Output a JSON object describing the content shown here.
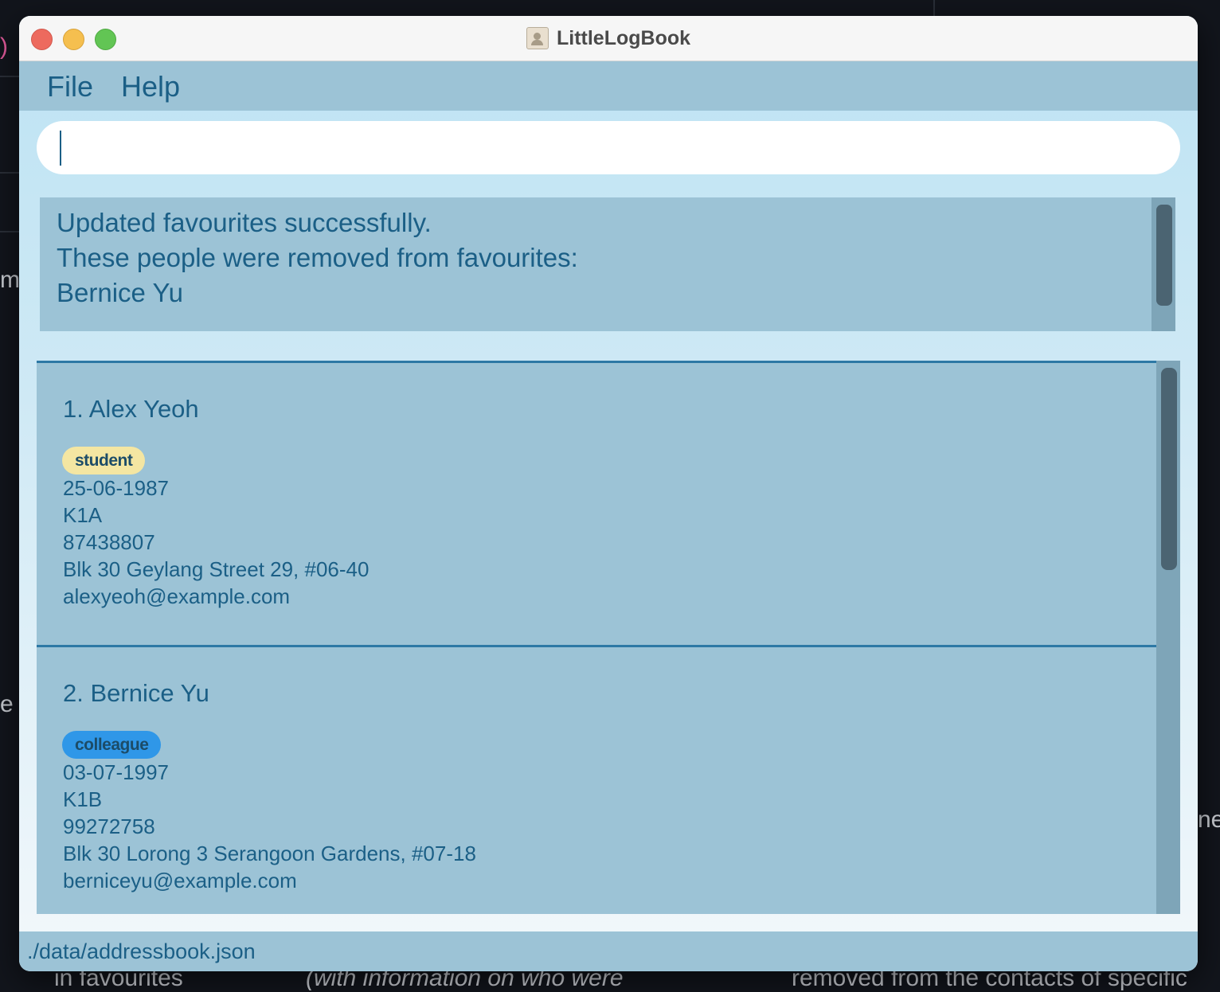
{
  "window": {
    "title": "LittleLogBook"
  },
  "menu": {
    "file": "File",
    "help": "Help"
  },
  "command": {
    "value": "",
    "placeholder": ""
  },
  "result": {
    "lines": [
      "Updated favourites successfully.",
      "These people were removed from favourites:",
      "Bernice Yu"
    ]
  },
  "persons": [
    {
      "name": "1. Alex Yeoh",
      "tag": "student",
      "birthday": "25-06-1987",
      "code": "K1A",
      "phone": "87438807",
      "address": "Blk 30 Geylang Street 29, #06-40",
      "email": "alexyeoh@example.com"
    },
    {
      "name": "2. Bernice Yu",
      "tag": "colleague",
      "birthday": "03-07-1997",
      "code": "K1B",
      "phone": "99272758",
      "address": "Blk 30 Lorong 3 Serangoon Gardens, #07-18",
      "email": "berniceyu@example.com"
    }
  ],
  "status": {
    "path": "./data/addressbook.json"
  },
  "background": {
    "snippets": [
      ")",
      "ma",
      "e",
      "ne",
      "in favourites",
      "(with information on who were",
      "removed from the contacts of specific"
    ]
  },
  "colors": {
    "menubar": "#9cc3d6",
    "accent_text": "#1b5f86",
    "tag_student": "#f4e6a2",
    "tag_colleague": "#2f97e8",
    "card_divider": "#2d78a5"
  }
}
